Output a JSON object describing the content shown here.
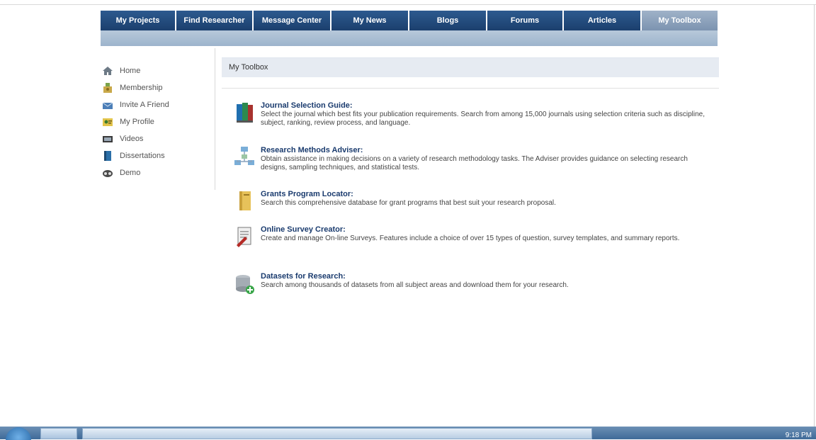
{
  "nav": {
    "tabs": [
      {
        "label": "My Projects"
      },
      {
        "label": "Find Researcher"
      },
      {
        "label": "Message Center"
      },
      {
        "label": "My News"
      },
      {
        "label": "Blogs"
      },
      {
        "label": "Forums"
      },
      {
        "label": "Articles"
      },
      {
        "label": "My Toolbox",
        "active": true
      }
    ]
  },
  "sidebar": {
    "items": [
      {
        "label": "Home",
        "icon": "home-icon"
      },
      {
        "label": "Membership",
        "icon": "membership-icon"
      },
      {
        "label": "Invite A Friend",
        "icon": "invite-icon"
      },
      {
        "label": "My Profile",
        "icon": "profile-icon"
      },
      {
        "label": "Videos",
        "icon": "video-icon"
      },
      {
        "label": "Dissertations",
        "icon": "book-icon"
      },
      {
        "label": "Demo",
        "icon": "demo-icon"
      }
    ]
  },
  "main": {
    "header": "My Toolbox",
    "tools": [
      {
        "title": "Journal Selection Guide:",
        "description": "Select the journal which best fits your publication requirements. Search from among 15,000 journals using selection criteria such as discipline, subject, ranking, review process, and language.",
        "icon": "journal-books-icon"
      },
      {
        "title": "Research Methods Adviser:",
        "description": "Obtain assistance in making decisions on a variety of research methodology tasks. The Adviser provides guidance on selecting research designs, sampling techniques, and statistical tests.",
        "icon": "flowchart-icon"
      },
      {
        "title": "Grants Program Locator:",
        "description": "Search this comprehensive database for grant programs that best suit your research proposal.",
        "icon": "folder-icon"
      },
      {
        "title": "Online Survey Creator:",
        "description": "Create and manage On-line Surveys. Features include a choice of over 15 types of question, survey templates, and summary reports.",
        "icon": "survey-icon"
      },
      {
        "title": "Datasets for Research:",
        "description": "Search among thousands of datasets from all subject areas and download them for your research.",
        "icon": "database-add-icon"
      }
    ]
  },
  "taskbar": {
    "clock": "9:18 PM"
  }
}
